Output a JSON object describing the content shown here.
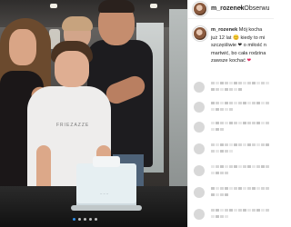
{
  "post": {
    "username": "m_rozenek",
    "follow_separator_label": "• Obserwu",
    "caption": {
      "line1_user": "m_rozenek",
      "line1_text": "Mój kocha",
      "line2": "już 12 lat 😊 kiedy to mi",
      "line3": "szczęśliwie ❤ o miłość n",
      "line4": "martwić, bo cała rodzina",
      "line5": "zawsze kochać"
    },
    "heart_icon": "❤"
  },
  "photo": {
    "shirt_print": "FRIEZAZZE",
    "cake_label": "~ ~ ~",
    "carousel": {
      "total": 5,
      "active_index": 0
    }
  },
  "colors": {
    "accent_blue": "#2f8fe8",
    "heart_red": "#e0245e",
    "text_dark": "#262626"
  }
}
